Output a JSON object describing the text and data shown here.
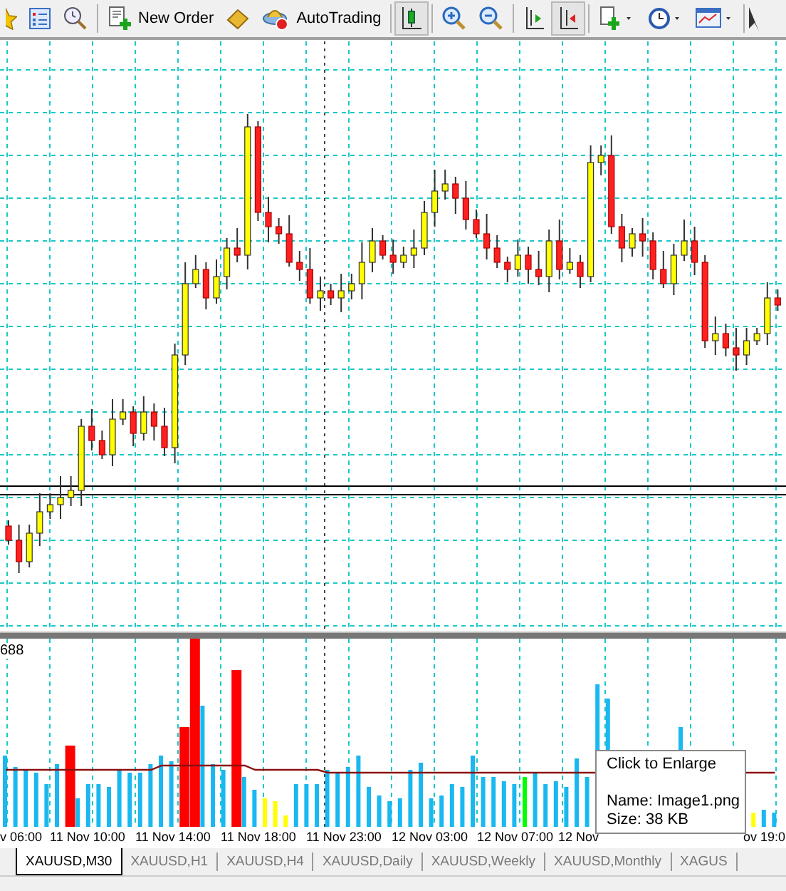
{
  "toolbar": [
    {
      "pressed": false
    },
    {
      "pressed": false
    },
    {
      "pressed": false
    },
    {
      "label": "New Order",
      "pressed": false
    },
    {
      "pressed": false
    },
    {
      "label": "AutoTrading",
      "pressed": false
    },
    {
      "pressed": true
    },
    {
      "pressed": false
    },
    {
      "pressed": false
    },
    {
      "pressed": false
    },
    {
      "pressed": true
    },
    {
      "pressed": false
    },
    {
      "pressed": false
    },
    {
      "pressed": false
    }
  ],
  "volume_label": "688",
  "time_axis": [
    "v 06:00",
    "11 Nov 10:00",
    "11 Nov 14:00",
    "11 Nov 18:00",
    "11 Nov 23:00",
    "12 Nov 03:00",
    "12 Nov 07:00",
    "12 Nov",
    "ov 19:0"
  ],
  "tooltip": {
    "title": "Click to Enlarge",
    "name": "Name: Image1.png",
    "size": "Size: 38 KB"
  },
  "tabs": [
    {
      "label": "XAUUSD,M30",
      "selected": true
    },
    {
      "label": "XAUUSD,H1",
      "selected": false
    },
    {
      "label": "XAUUSD,H4",
      "selected": false
    },
    {
      "label": "XAUUSD,Daily",
      "selected": false
    },
    {
      "label": "XAUUSD,Weekly",
      "selected": false
    },
    {
      "label": "XAUUSD,Monthly",
      "selected": false
    },
    {
      "label": "XAGUS",
      "selected": false
    }
  ]
}
